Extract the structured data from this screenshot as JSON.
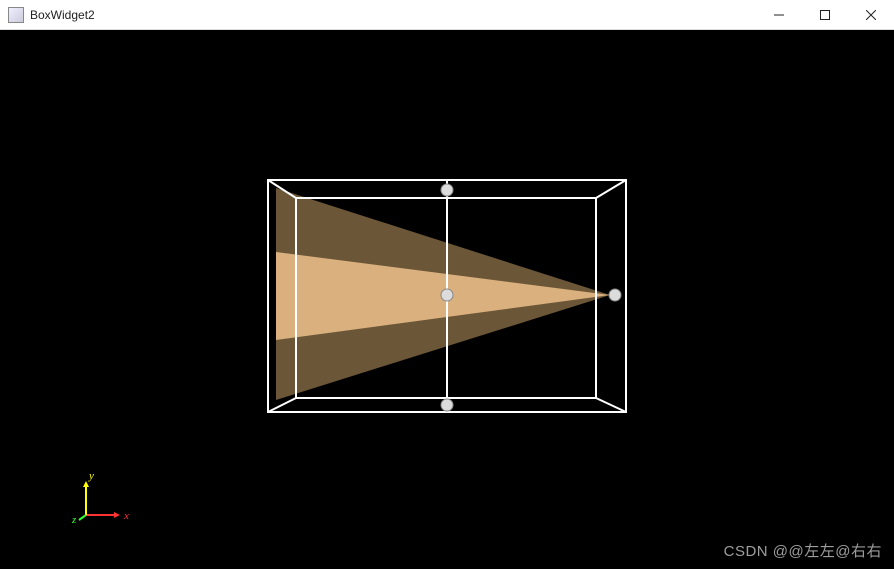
{
  "window": {
    "title": "BoxWidget2",
    "controls": {
      "minimize": "—",
      "maximize": "☐",
      "close": "✕"
    }
  },
  "axes": {
    "x_label": "x",
    "y_label": "y",
    "z_label": "z",
    "x_color": "#ff3333",
    "y_color": "#ffff00",
    "z_color": "#33ff33"
  },
  "watermark": "CSDN @@左左@右右",
  "scene": {
    "cone_color_light": "#d9b07e",
    "cone_color_dark": "#6b5738",
    "box_outline_color": "#ffffff",
    "handle_fill": "#dcdcdc",
    "handle_stroke": "#888888"
  }
}
